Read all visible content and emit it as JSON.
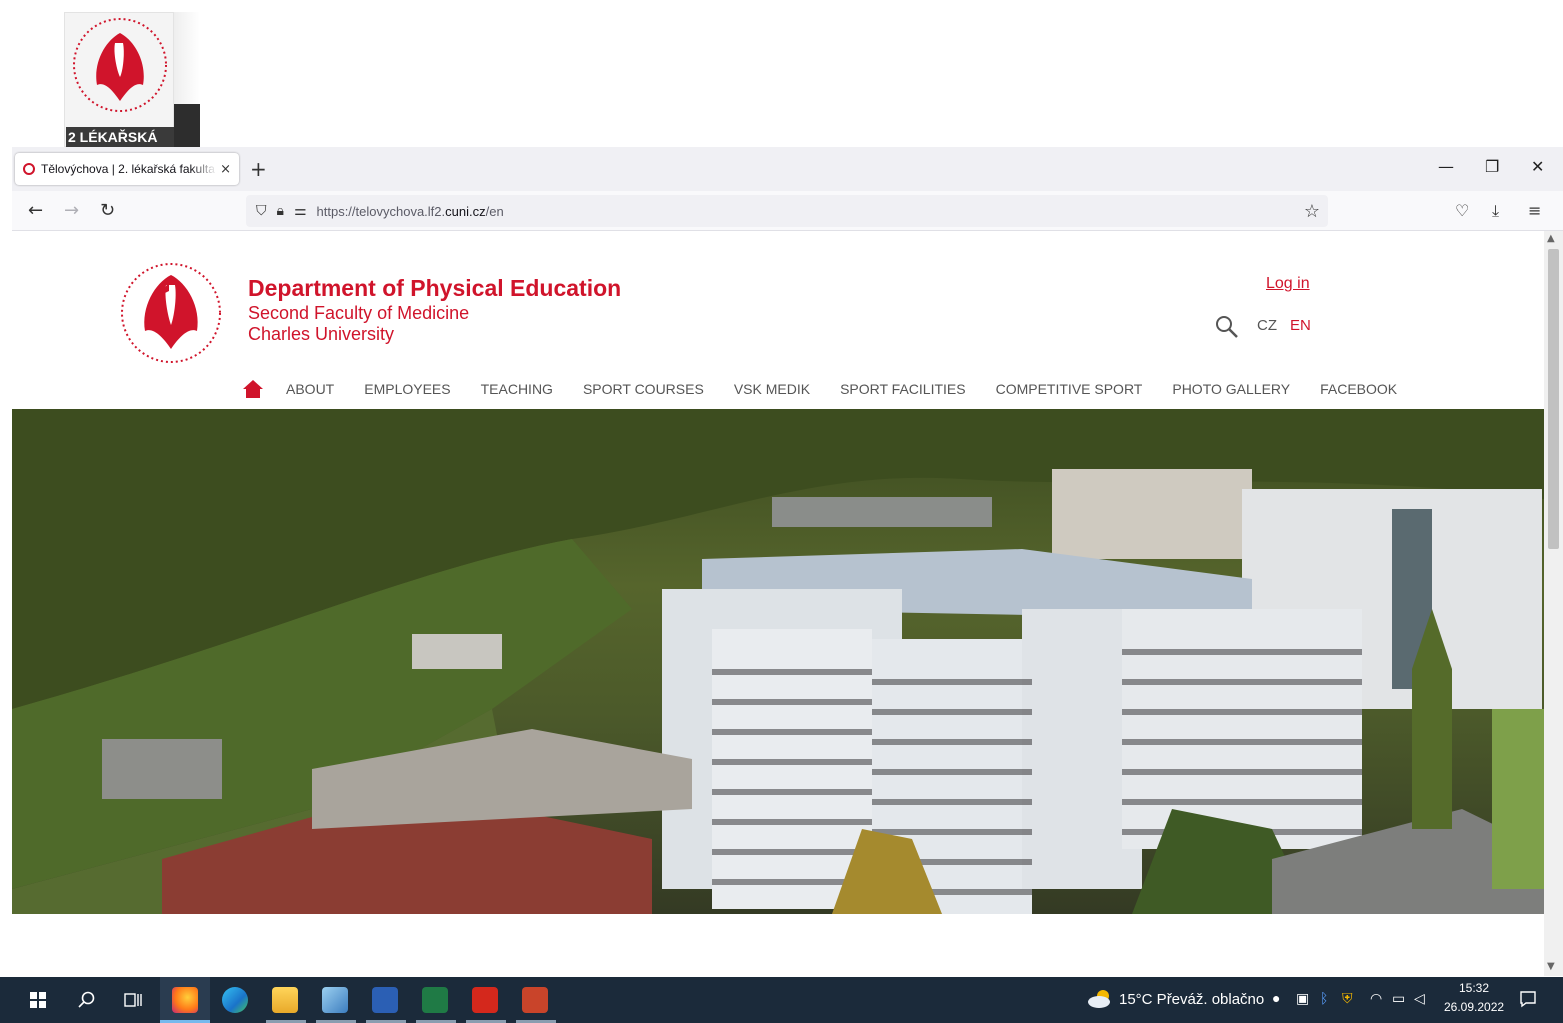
{
  "desktop": {
    "icon_caption": "2 LÉKAŘSKÁ"
  },
  "browser": {
    "tab_title": "Tělovýchova | 2. lékařská fakulta",
    "tab_close": "×",
    "new_tab": "+",
    "window_minimize": "—",
    "window_restore": "❐",
    "window_close": "✕",
    "url_prefix": "https://telovychova.lf2.",
    "url_domain": "cuni.cz",
    "url_suffix": "/en"
  },
  "site": {
    "title": "Department of Physical Education",
    "subtitle_1": "Second Faculty of Medicine",
    "subtitle_2": "Charles University",
    "login": "Log in",
    "lang_cz": "CZ",
    "lang_en": "EN",
    "menu": [
      "ABOUT",
      "EMPLOYEES",
      "TEACHING",
      "SPORT COURSES",
      "VSK MEDIK",
      "SPORT FACILITIES",
      "COMPETITIVE SPORT",
      "PHOTO GALLERY",
      "FACEBOOK"
    ],
    "accent_color": "#d0142b"
  },
  "taskbar": {
    "weather": "15°C Převáž. oblačno",
    "time": "15:32",
    "date": "26.09.2022"
  }
}
